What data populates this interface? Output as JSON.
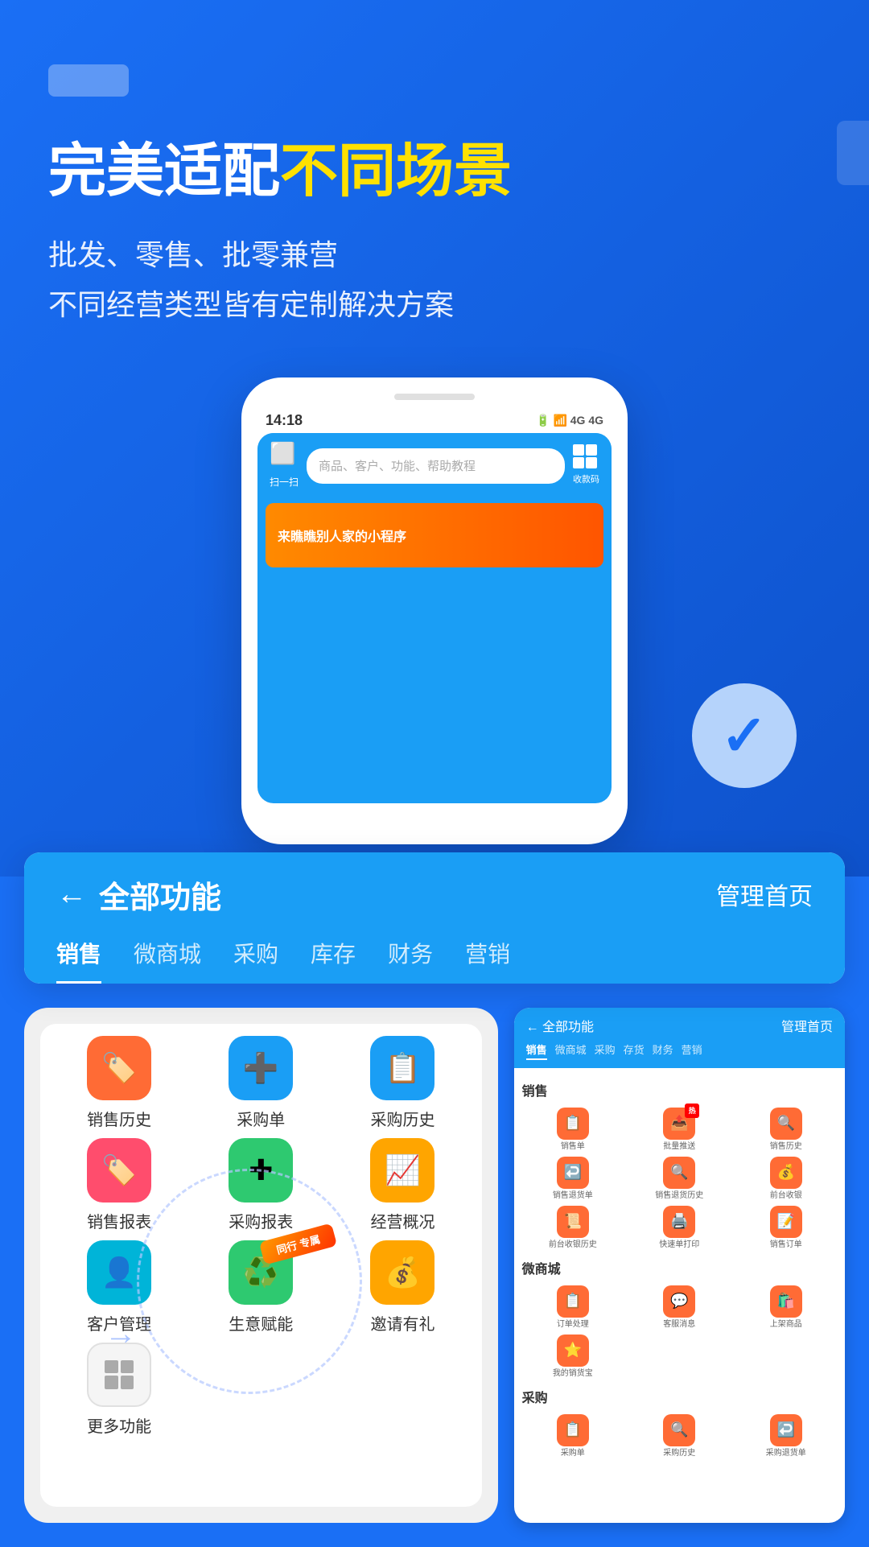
{
  "hero": {
    "badge_text": "",
    "title_part1": "完美适配",
    "title_highlight": "不同场景",
    "subtitle_line1": "批发、零售、批零兼营",
    "subtitle_line2": "不同经营类型皆有定制解决方案"
  },
  "phone_mockup": {
    "status_time": "14:18",
    "status_icons": "📶 4G 4G",
    "search_placeholder": "商品、客户、功能、帮助教程",
    "scan_label": "扫一扫",
    "qr_label": "收款码",
    "banner_text": "来瞧瞧别人家的小程序"
  },
  "function_card": {
    "back_label": "← 全部功能",
    "manage_label": "管理首页",
    "tabs": [
      "销售",
      "微商城",
      "采购",
      "库存",
      "财务",
      "营销"
    ]
  },
  "icon_grid_left": [
    {
      "label": "销售历史",
      "emoji": "🏷️",
      "color": "icon-orange"
    },
    {
      "label": "采购单",
      "emoji": "➕",
      "color": "icon-blue"
    },
    {
      "label": "采购历史",
      "emoji": "📋",
      "color": "icon-blue"
    },
    {
      "label": "销售报表",
      "emoji": "🏷️",
      "color": "icon-pink"
    },
    {
      "label": "采购报表",
      "emoji": "✚",
      "color": "icon-green"
    },
    {
      "label": "经营概况",
      "emoji": "📈",
      "color": "icon-gold"
    },
    {
      "label": "客户管理",
      "emoji": "👤",
      "color": "icon-teal"
    },
    {
      "label": "生意赋能",
      "emoji": "⭕",
      "color": "icon-green"
    },
    {
      "label": "邀请有礼",
      "emoji": "💰",
      "color": "icon-gold"
    },
    {
      "label": "更多功能",
      "emoji": "",
      "color": "more"
    }
  ],
  "right_phone": {
    "header_back": "← 全部功能",
    "header_manage": "管理首页",
    "tabs": [
      "销售",
      "微商城",
      "采购",
      "存货",
      "财务",
      "营销"
    ],
    "sections": [
      {
        "title": "销售",
        "icons": [
          {
            "label": "销售单",
            "emoji": "📋",
            "color": "#ff6b35"
          },
          {
            "label": "批量推送",
            "emoji": "📤",
            "color": "#ff6b35"
          },
          {
            "label": "销售历史",
            "emoji": "🔍",
            "color": "#ff6b35"
          },
          {
            "label": "销售退货单",
            "emoji": "↩️",
            "color": "#ff6b35"
          },
          {
            "label": "销售退货历史",
            "emoji": "🔍",
            "color": "#ff6b35"
          },
          {
            "label": "前台收银",
            "emoji": "💰",
            "color": "#ff6b35"
          },
          {
            "label": "前台收银历史",
            "emoji": "📜",
            "color": "#ff6b35"
          },
          {
            "label": "快速单打印",
            "emoji": "🖨️",
            "color": "#ff6b35"
          },
          {
            "label": "销售订单",
            "emoji": "📝",
            "color": "#ff6b35"
          }
        ]
      },
      {
        "title": "微商城",
        "icons": [
          {
            "label": "订单处理",
            "emoji": "📋",
            "color": "#ff6b35"
          },
          {
            "label": "客服消息",
            "emoji": "💬",
            "color": "#ff6b35"
          },
          {
            "label": "上架商品",
            "emoji": "🛍️",
            "color": "#ff6b35"
          },
          {
            "label": "我的销货宝",
            "emoji": "⭐",
            "color": "#ff6b35"
          }
        ]
      },
      {
        "title": "采购",
        "icons": [
          {
            "label": "采购单",
            "emoji": "📋",
            "color": "#ff6b35"
          },
          {
            "label": "采购历史",
            "emoji": "🔍",
            "color": "#ff6b35"
          },
          {
            "label": "采购退货单",
            "emoji": "↩️",
            "color": "#ff6b35"
          }
        ]
      }
    ]
  }
}
